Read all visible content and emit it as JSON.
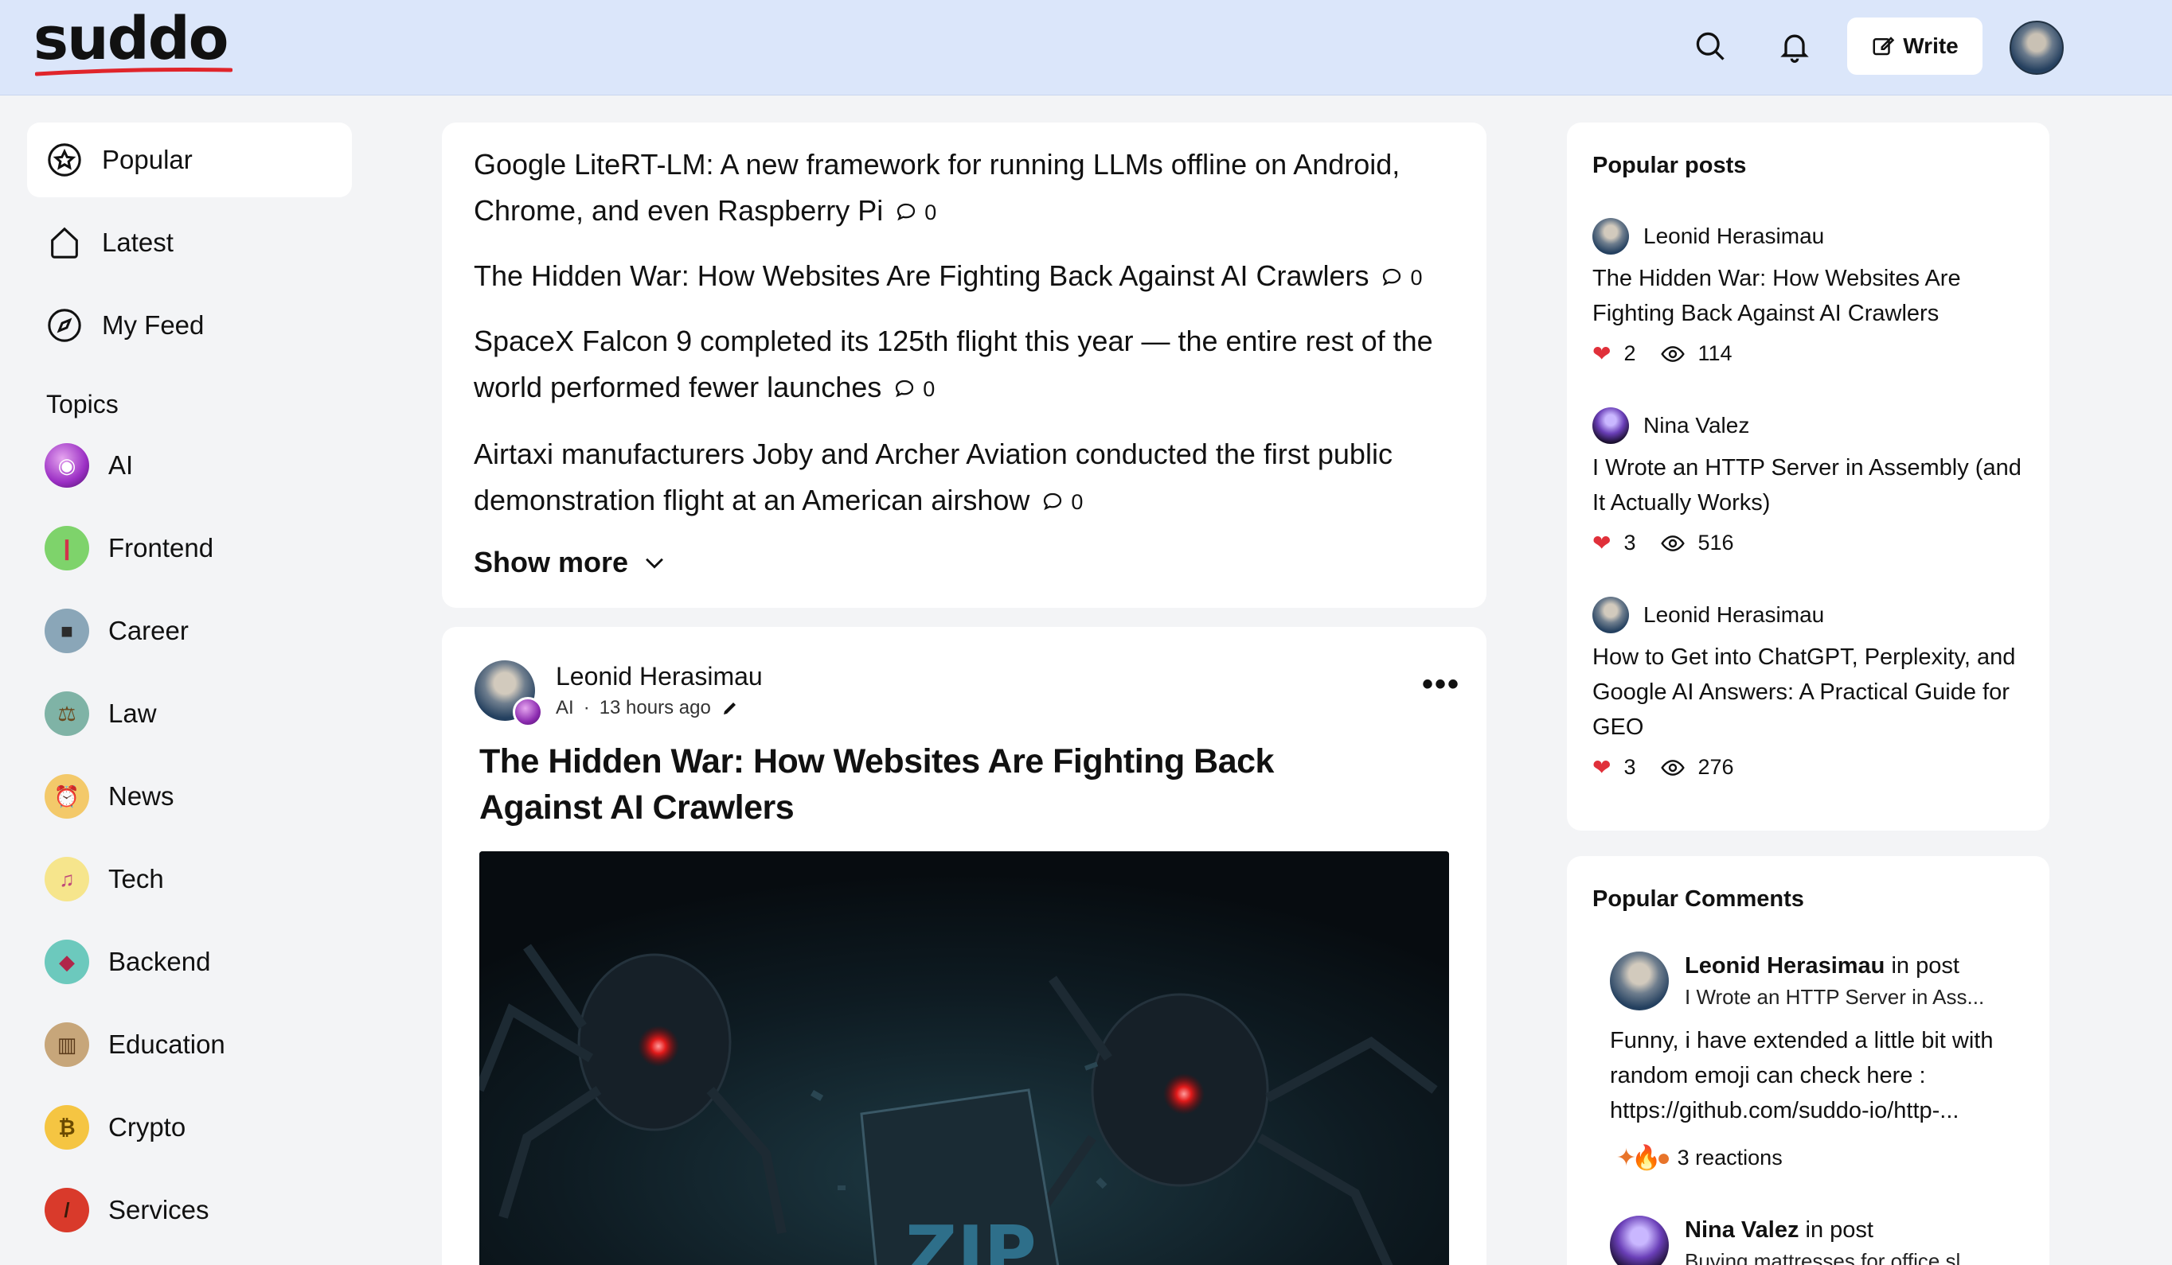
{
  "header": {
    "logo": "suddo",
    "write_label": "Write",
    "icons": [
      "search-icon",
      "bell-icon",
      "edit-icon"
    ],
    "brand_accent": "#e0252b",
    "header_bg": "#dbe6fa"
  },
  "nav": {
    "items": [
      {
        "label": "Popular",
        "icon": "star-icon",
        "active": true
      },
      {
        "label": "Latest",
        "icon": "home-icon"
      },
      {
        "label": "My Feed",
        "icon": "compass-icon"
      }
    ],
    "topics_label": "Topics",
    "topics": [
      {
        "label": "AI",
        "color": "#9b2fc4",
        "glyph": "◉"
      },
      {
        "label": "Frontend",
        "color": "#7ed36b",
        "glyph": "❙"
      },
      {
        "label": "Career",
        "color": "#8aa6b8",
        "glyph": "■"
      },
      {
        "label": "Law",
        "color": "#7fb3a6",
        "glyph": "⚖"
      },
      {
        "label": "News",
        "color": "#f3c96a",
        "glyph": "⏰"
      },
      {
        "label": "Tech",
        "color": "#f6e58c",
        "glyph": "♫"
      },
      {
        "label": "Backend",
        "color": "#6cc9bd",
        "glyph": "◆"
      },
      {
        "label": "Education",
        "color": "#c7a67a",
        "glyph": "▥"
      },
      {
        "label": "Crypto",
        "color": "#f5c542",
        "glyph": "₿"
      },
      {
        "label": "Services",
        "color": "#d93a2b",
        "glyph": "/"
      }
    ]
  },
  "feed": {
    "top_list": [
      {
        "title": "Google LiteRT-LM: A new framework for running LLMs offline on Android, Chrome, and even Raspberry Pi",
        "comments": "0"
      },
      {
        "title": "The Hidden War: How Websites Are Fighting Back Against AI Crawlers",
        "comments": "0"
      },
      {
        "title": "SpaceX Falcon 9 completed its 125th flight this year — the entire rest of the world performed fewer launches",
        "comments": "0"
      },
      {
        "title": "Airtaxi manufacturers Joby and Archer Aviation conducted the first public demonstration flight at an American airshow",
        "comments": "0"
      }
    ],
    "show_more": "Show more",
    "post": {
      "author": "Leonid Herasimau",
      "topic": "AI",
      "separator": "·",
      "time": "13 hours ago",
      "title": "The Hidden War: How Websites Are Fighting Back Against AI Crawlers",
      "image_text": "ZIP"
    }
  },
  "popular_posts": {
    "title": "Popular posts",
    "items": [
      {
        "author": "Leonid Herasimau",
        "title": "The Hidden War: How Websites Are Fighting Back Against AI Crawlers",
        "likes": "2",
        "views": "114"
      },
      {
        "author": "Nina Valez",
        "title": "I Wrote an HTTP Server in Assembly (and It Actually Works)",
        "likes": "3",
        "views": "516"
      },
      {
        "author": "Leonid Herasimau",
        "title": "How to Get into ChatGPT, Perplexity, and Google AI Answers: A Practical Guide for GEO",
        "likes": "3",
        "views": "276"
      }
    ]
  },
  "popular_comments": {
    "title": "Popular Comments",
    "in_post": "in post",
    "items": [
      {
        "author": "Leonid Herasimau",
        "post": "I Wrote an HTTP Server in Ass...",
        "body": "Funny, i have extended a little bit with random emoji can check here : https://github.com/suddo-io/http-...",
        "reactions": "3 reactions"
      },
      {
        "author": "Nina Valez",
        "post": "Buying mattresses for office sl..."
      }
    ]
  }
}
